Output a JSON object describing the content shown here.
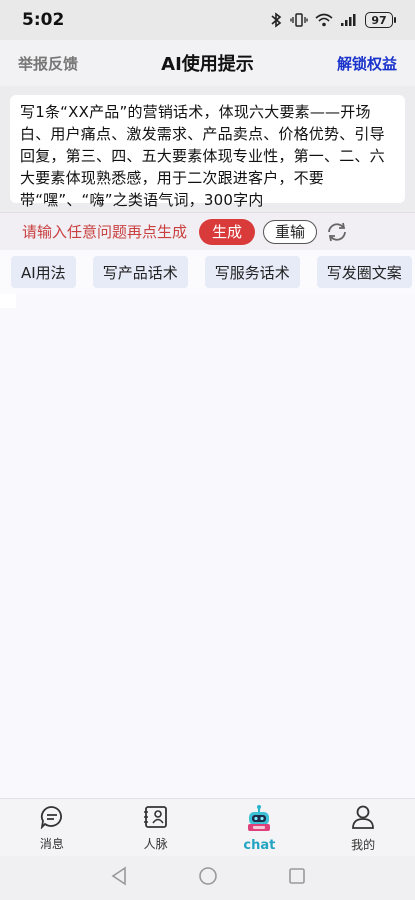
{
  "status_bar": {
    "time": "5:02",
    "battery": "97"
  },
  "header": {
    "report": "举报反馈",
    "title": "AI使用提示",
    "unlock": "解锁权益"
  },
  "prompt": {
    "text": "写1条“XX产品”的营销话术，体现六大要素——开场白、用户痛点、激发需求、产品卖点、价格优势、引导回复，第三、四、五大要素体现专业性，第一、二、六大要素体现熟悉感，用于二次跟进客户，不要带“嘿”、“嗨”之类语气词，300字内"
  },
  "actions": {
    "hint": "请输入任意问题再点生成",
    "generate": "生成",
    "reenter": "重输"
  },
  "chips": [
    "AI用法",
    "写产品话术",
    "写服务话术",
    "写发圈文案"
  ],
  "bottom_nav": {
    "items": [
      {
        "label": "消息",
        "icon": "message-icon"
      },
      {
        "label": "人脉",
        "icon": "contacts-icon"
      },
      {
        "label": "chat",
        "icon": "robot-icon",
        "active": true
      },
      {
        "label": "我的",
        "icon": "profile-icon"
      }
    ]
  },
  "colors": {
    "accent_red": "#d93b3b",
    "link_blue": "#1a33cc",
    "active_tab": "#23a4c2"
  }
}
